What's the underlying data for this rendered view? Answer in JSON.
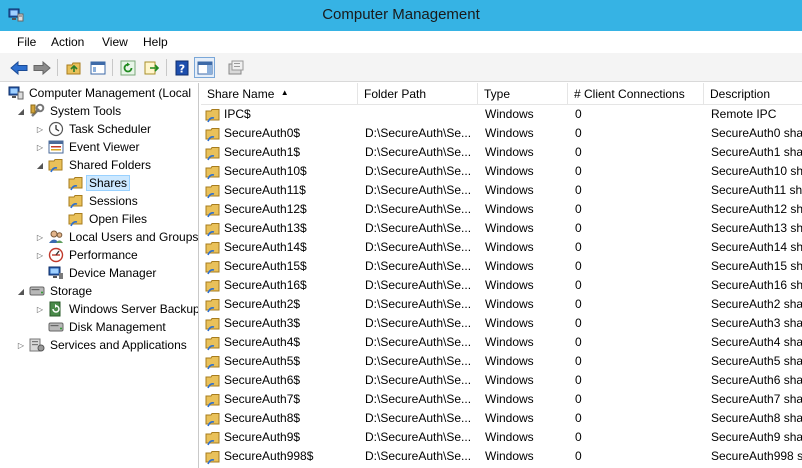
{
  "window": {
    "title": "Computer Management"
  },
  "menu": [
    "File",
    "Action",
    "View",
    "Help"
  ],
  "toolbar": {
    "buttons": [
      "back-icon",
      "forward-icon",
      "up-folder-icon",
      "show-hide-tree-icon",
      "refresh-icon",
      "export-list-icon",
      "help-icon",
      "action-pane-icon",
      "share-properties-icon"
    ]
  },
  "tree": {
    "items": [
      {
        "label": "Computer Management (Local",
        "icon": "computer-management-icon",
        "expander": "",
        "level": 0
      },
      {
        "label": "System Tools",
        "icon": "system-tools-icon",
        "expander": "◢",
        "level": 1
      },
      {
        "label": "Task Scheduler",
        "icon": "clock-icon",
        "expander": "▷",
        "level": 2
      },
      {
        "label": "Event Viewer",
        "icon": "event-viewer-icon",
        "expander": "▷",
        "level": 2
      },
      {
        "label": "Shared Folders",
        "icon": "shared-folder-icon",
        "expander": "◢",
        "level": 2
      },
      {
        "label": "Shares",
        "icon": "shared-folder-icon",
        "expander": "",
        "level": 3,
        "selected": true
      },
      {
        "label": "Sessions",
        "icon": "shared-folder-icon",
        "expander": "",
        "level": 3
      },
      {
        "label": "Open Files",
        "icon": "shared-folder-icon",
        "expander": "",
        "level": 3
      },
      {
        "label": "Local Users and Groups",
        "icon": "users-icon",
        "expander": "▷",
        "level": 2
      },
      {
        "label": "Performance",
        "icon": "performance-icon",
        "expander": "▷",
        "level": 2
      },
      {
        "label": "Device Manager",
        "icon": "device-manager-icon",
        "expander": "",
        "level": 2
      },
      {
        "label": "Storage",
        "icon": "storage-icon",
        "expander": "◢",
        "level": 1
      },
      {
        "label": "Windows Server Backup",
        "icon": "backup-icon",
        "expander": "▷",
        "level": 2
      },
      {
        "label": "Disk Management",
        "icon": "disk-icon",
        "expander": "",
        "level": 2
      },
      {
        "label": "Services and Applications",
        "icon": "services-icon",
        "expander": "▷",
        "level": 1
      }
    ]
  },
  "columns": [
    {
      "label": "Share Name",
      "sorted": "▲"
    },
    {
      "label": "Folder Path"
    },
    {
      "label": "Type"
    },
    {
      "label": "# Client Connections"
    },
    {
      "label": "Description"
    }
  ],
  "rows": [
    {
      "name": "IPC$",
      "path": "",
      "type": "Windows",
      "connections": "0",
      "description": "Remote IPC"
    },
    {
      "name": "SecureAuth0$",
      "path": "D:\\SecureAuth\\Se...",
      "type": "Windows",
      "connections": "0",
      "description": "SecureAuth0 sha"
    },
    {
      "name": "SecureAuth1$",
      "path": "D:\\SecureAuth\\Se...",
      "type": "Windows",
      "connections": "0",
      "description": "SecureAuth1 sha"
    },
    {
      "name": "SecureAuth10$",
      "path": "D:\\SecureAuth\\Se...",
      "type": "Windows",
      "connections": "0",
      "description": "SecureAuth10 sh"
    },
    {
      "name": "SecureAuth11$",
      "path": "D:\\SecureAuth\\Se...",
      "type": "Windows",
      "connections": "0",
      "description": "SecureAuth11 sh"
    },
    {
      "name": "SecureAuth12$",
      "path": "D:\\SecureAuth\\Se...",
      "type": "Windows",
      "connections": "0",
      "description": "SecureAuth12 sh"
    },
    {
      "name": "SecureAuth13$",
      "path": "D:\\SecureAuth\\Se...",
      "type": "Windows",
      "connections": "0",
      "description": "SecureAuth13 sh"
    },
    {
      "name": "SecureAuth14$",
      "path": "D:\\SecureAuth\\Se...",
      "type": "Windows",
      "connections": "0",
      "description": "SecureAuth14 sh"
    },
    {
      "name": "SecureAuth15$",
      "path": "D:\\SecureAuth\\Se...",
      "type": "Windows",
      "connections": "0",
      "description": "SecureAuth15 sh"
    },
    {
      "name": "SecureAuth16$",
      "path": "D:\\SecureAuth\\Se...",
      "type": "Windows",
      "connections": "0",
      "description": "SecureAuth16 sh"
    },
    {
      "name": "SecureAuth2$",
      "path": "D:\\SecureAuth\\Se...",
      "type": "Windows",
      "connections": "0",
      "description": "SecureAuth2 sha"
    },
    {
      "name": "SecureAuth3$",
      "path": "D:\\SecureAuth\\Se...",
      "type": "Windows",
      "connections": "0",
      "description": "SecureAuth3 sha"
    },
    {
      "name": "SecureAuth4$",
      "path": "D:\\SecureAuth\\Se...",
      "type": "Windows",
      "connections": "0",
      "description": "SecureAuth4 sha"
    },
    {
      "name": "SecureAuth5$",
      "path": "D:\\SecureAuth\\Se...",
      "type": "Windows",
      "connections": "0",
      "description": "SecureAuth5 sha"
    },
    {
      "name": "SecureAuth6$",
      "path": "D:\\SecureAuth\\Se...",
      "type": "Windows",
      "connections": "0",
      "description": "SecureAuth6 sha"
    },
    {
      "name": "SecureAuth7$",
      "path": "D:\\SecureAuth\\Se...",
      "type": "Windows",
      "connections": "0",
      "description": "SecureAuth7 sha"
    },
    {
      "name": "SecureAuth8$",
      "path": "D:\\SecureAuth\\Se...",
      "type": "Windows",
      "connections": "0",
      "description": "SecureAuth8 sha"
    },
    {
      "name": "SecureAuth9$",
      "path": "D:\\SecureAuth\\Se...",
      "type": "Windows",
      "connections": "0",
      "description": "SecureAuth9 sha"
    },
    {
      "name": "SecureAuth998$",
      "path": "D:\\SecureAuth\\Se...",
      "type": "Windows",
      "connections": "0",
      "description": "SecureAuth998 s"
    }
  ],
  "colors": {
    "titlebar": "#36b3e4",
    "selection": "#cce8ff",
    "toolbar": "#f4f4f4"
  }
}
